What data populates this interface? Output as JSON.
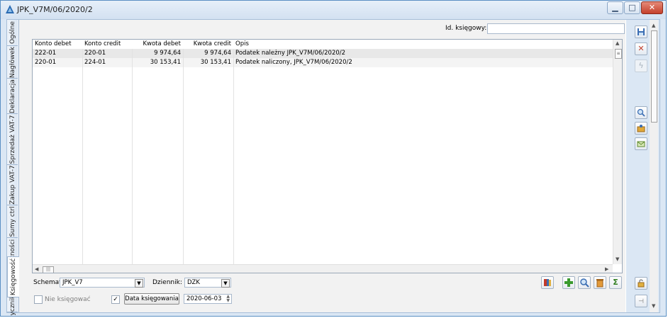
{
  "window": {
    "title": "JPK_V7M/06/2020/2",
    "controls": [
      "minimize",
      "maximize",
      "close"
    ]
  },
  "tabs": [
    {
      "label": "Ogólne"
    },
    {
      "label": "Nagłówek"
    },
    {
      "label": "Deklaracja"
    },
    {
      "label": "Sprzedaż VAT-7"
    },
    {
      "label": "Zakup VAT-7"
    },
    {
      "label": "Sumy ctrl"
    },
    {
      "label": "Płatności"
    },
    {
      "label": "Księgowość"
    },
    {
      "label": "yczniki"
    }
  ],
  "id_ksiegowy": {
    "label": "Id. księgowy:",
    "value": ""
  },
  "table": {
    "columns": [
      "Konto debet",
      "Konto credit",
      "Kwota debet",
      "Kwota credit",
      "Opis"
    ],
    "rows": [
      {
        "konto_debet": "222-01",
        "konto_credit": "220-01",
        "kwota_debet": "9 974,64",
        "kwota_credit": "9 974,64",
        "opis": "Podatek należny JPK_V7M/06/2020/2"
      },
      {
        "konto_debet": "220-01",
        "konto_credit": "224-01",
        "kwota_debet": "30 153,41",
        "kwota_credit": "30 153,41",
        "opis": "Podatek naliczony, JPK_V7M/06/2020/2"
      }
    ]
  },
  "footer": {
    "schemat_label": "Schemat:",
    "schemat_value": "JPK_V7",
    "dziennik_label": "Dziennik:",
    "dziennik_value": "DZK",
    "nie_ksiegowac_label": "Nie księgować",
    "data_ksiegowania_button": "Data księgowania",
    "data_value": "2020-06-03",
    "checkbox_checked": "✓"
  },
  "icons": {
    "save": "floppy-disk-icon",
    "cancel": "cross-icon",
    "disabled": "lightning-icon",
    "zoom": "magnifier-icon",
    "basket": "basket-icon",
    "envelope": "envelope-icon",
    "book": "book-icon",
    "add": "plus-icon",
    "search": "magnifier-icon",
    "delete": "trash-icon",
    "sum": "sigma-icon",
    "lock": "lock-icon",
    "pin": "pin-icon"
  },
  "colors": {
    "accent_green": "#3a9a2e",
    "close_red": "#c4402b",
    "delete_red": "#c23a2a",
    "title_bar": "#dbe7f4"
  }
}
